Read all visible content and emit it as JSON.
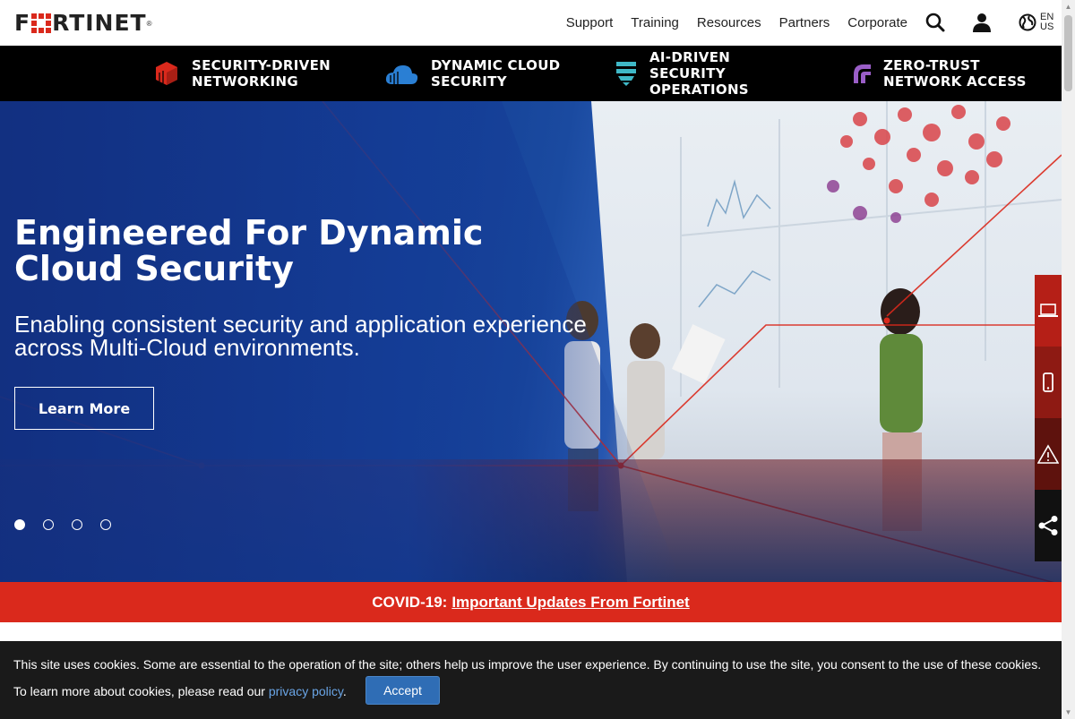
{
  "brand": {
    "logo_text_left": "F",
    "logo_text_right": "RTINET",
    "logo_tm": "®",
    "accent": "#da291c"
  },
  "topnav": {
    "items": [
      {
        "label": "Support"
      },
      {
        "label": "Training"
      },
      {
        "label": "Resources"
      },
      {
        "label": "Partners"
      },
      {
        "label": "Corporate"
      }
    ],
    "lang_top": "EN",
    "lang_bottom": "US"
  },
  "products": [
    {
      "line1": "Security-Driven",
      "line2": "Networking",
      "color": "#da291c"
    },
    {
      "line1": "Dynamic Cloud",
      "line2": "Security",
      "color": "#2a7fd4"
    },
    {
      "line1": "AI-Driven Security",
      "line2": "Operations",
      "color": "#3fb8c7"
    },
    {
      "line1": "Zero-Trust",
      "line2": "Network Access",
      "color": "#9a5ec7"
    }
  ],
  "hero": {
    "title": "Engineered For Dynamic Cloud Security",
    "subtitle": "Enabling consistent security and application experience across Multi-Cloud environments.",
    "cta": "Learn More",
    "slides": 4,
    "active_slide": 1
  },
  "covid": {
    "prefix": "COVID-19:",
    "link": "Important Updates From Fortinet"
  },
  "cookie": {
    "line1": "This site uses cookies. Some are essential to the operation of the site; others help us improve the user experience. By continuing to use the site, you consent to the use of these cookies.",
    "line2_prefix": "To learn more about cookies, please read our ",
    "line2_link": "privacy policy",
    "line2_suffix": ".",
    "accept": "Accept"
  }
}
